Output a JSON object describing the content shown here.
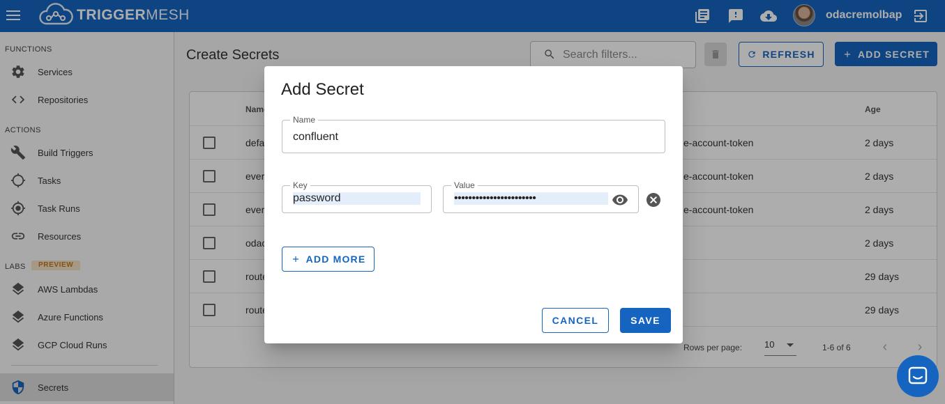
{
  "app": {
    "logo_bold": "TRIGGER",
    "logo_rest": "MESH",
    "username": "odacremolbap"
  },
  "colors": {
    "primary": "#1565c0",
    "preview_badge_bg": "#f3e0c4",
    "preview_badge_fg": "#c07a1e"
  },
  "icons": [
    "menu-icon",
    "docs-icon",
    "feedback-icon",
    "cloud-download-icon",
    "logout-icon"
  ],
  "sidebar": {
    "functions_label": "FUNCTIONS",
    "actions_label": "ACTIONS",
    "labs_label": "LABS",
    "preview_badge": "PREVIEW",
    "items": [
      {
        "label": "Services",
        "icon": "gear-icon"
      },
      {
        "label": "Repositories",
        "icon": "code-icon"
      },
      {
        "label": "Build Triggers",
        "icon": "wrench-icon"
      },
      {
        "label": "Tasks",
        "icon": "crosshair-icon"
      },
      {
        "label": "Task Runs",
        "icon": "target-icon"
      },
      {
        "label": "Resources",
        "icon": "link-icon"
      },
      {
        "label": "AWS Lambdas",
        "icon": "layers-icon"
      },
      {
        "label": "Azure Functions",
        "icon": "layers-icon"
      },
      {
        "label": "GCP Cloud Runs",
        "icon": "layers-icon"
      },
      {
        "label": "Secrets",
        "icon": "shield-icon",
        "active": true
      }
    ]
  },
  "main": {
    "title": "Create Secrets",
    "search_placeholder": "Search filters...",
    "refresh_label": "REFRESH",
    "add_secret_label": "ADD SECRET",
    "table": {
      "headers": {
        "name": "Name",
        "age": "Age"
      },
      "rows": [
        {
          "name": "defa",
          "type": "e-account-token",
          "age": "2 days"
        },
        {
          "name": "ever",
          "type": "e-account-token",
          "age": "2 days"
        },
        {
          "name": "ever",
          "type": "e-account-token",
          "age": "2 days"
        },
        {
          "name": "odac",
          "type": "",
          "age": "2 days"
        },
        {
          "name": "route",
          "type": "",
          "age": "29 days"
        },
        {
          "name": "route",
          "type": "",
          "age": "29 days"
        }
      ],
      "rows_per_page_label": "Rows per page:",
      "rows_per_page_value": "10",
      "range_label": "1-6 of 6"
    }
  },
  "dialog": {
    "title": "Add Secret",
    "name_label": "Name",
    "name_value": "confluent",
    "key_label": "Key",
    "key_value": "password",
    "value_label": "Value",
    "value_masked": "•••••••••••••••••••••••",
    "add_more_label": "ADD MORE",
    "cancel_label": "CANCEL",
    "save_label": "SAVE"
  }
}
